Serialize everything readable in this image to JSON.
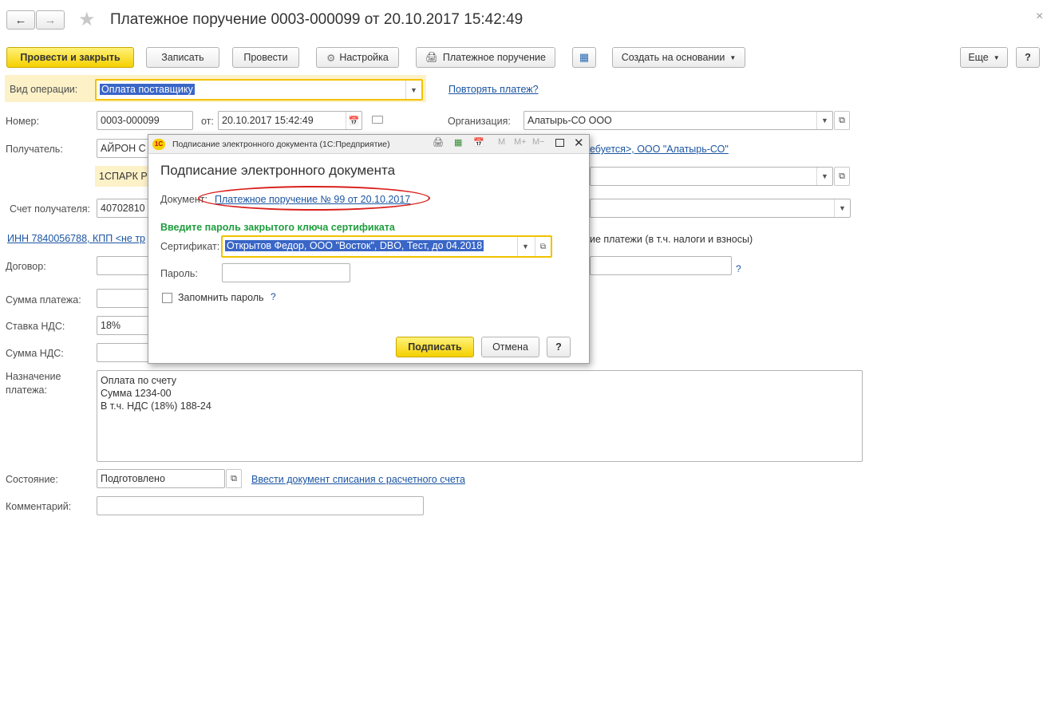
{
  "window": {
    "title": "Платежное поручение 0003-000099 от 20.10.2017 15:42:49",
    "close": "×"
  },
  "toolbar": {
    "post_close": "Провести и закрыть",
    "save": "Записать",
    "post": "Провести",
    "settings": "Настройка",
    "print": "Платежное поручение",
    "create_based": "Создать на основании",
    "more": "Еще",
    "help": "?"
  },
  "form": {
    "op_type_label": "Вид операции:",
    "op_type_value": "Оплата поставщику",
    "repeat_link": "Повторять платеж?",
    "number_label": "Номер:",
    "number_value": "0003-000099",
    "from_label": "от:",
    "date_value": "20.10.2017 15:42:49",
    "org_label": "Организация:",
    "org_value": "Алатырь-СО ООО",
    "recipient_label": "Получатель:",
    "recipient_value": "АЙРОН С",
    "recipient_link": "ебуется>, ООО \"Алатырь-СО\"",
    "spark_value": "1СПАРК Р",
    "account_label": "Счет получателя:",
    "account_value": "40702810",
    "inn_link": "ИНН 7840056788, КПП <не тр",
    "tax_text": "ие платежи (в т.ч. налоги и взносы)",
    "contract_label": "Договор:",
    "contract_help": "?",
    "sum_label": "Сумма платежа:",
    "vat_rate_label": "Ставка НДС:",
    "vat_rate_value": "18%",
    "vat_sum_label": "Сумма НДС:",
    "purpose_label_1": "Назначение",
    "purpose_label_2": "платежа:",
    "purpose_lines": [
      "Оплата по счету",
      "Сумма 1234-00",
      "В т.ч. НДС  (18%) 188-24"
    ],
    "status_label": "Состояние:",
    "status_value": "Подготовлено",
    "status_link": "Ввести документ списания с расчетного счета",
    "comment_label": "Комментарий:"
  },
  "dialog": {
    "window_title": "Подписание электронного документа  (1С:Предприятие)",
    "app_badge": "1C",
    "heading": "Подписание электронного документа",
    "doc_label": "Документ:",
    "doc_link": "Платежное поручение № 99 от 20.10.2017",
    "prompt": "Введите пароль закрытого ключа сертификата",
    "cert_label": "Сертификат:",
    "cert_value": "Открытов Федор, ООО \"Восток\", DBO, Тест, до 04.2018",
    "password_label": "Пароль:",
    "remember_label": "Запомнить пароль",
    "remember_help": "?",
    "sign": "Подписать",
    "cancel": "Отмена",
    "help": "?",
    "tb_m": "M",
    "tb_mplus": "M+",
    "tb_mminus": "M−"
  },
  "colors": {
    "accent_yellow": "#f5d000",
    "link_blue": "#1c55a2",
    "prompt_green": "#1e9e3e",
    "annotation_red": "#d9201c",
    "selection_blue": "#3966c7"
  }
}
